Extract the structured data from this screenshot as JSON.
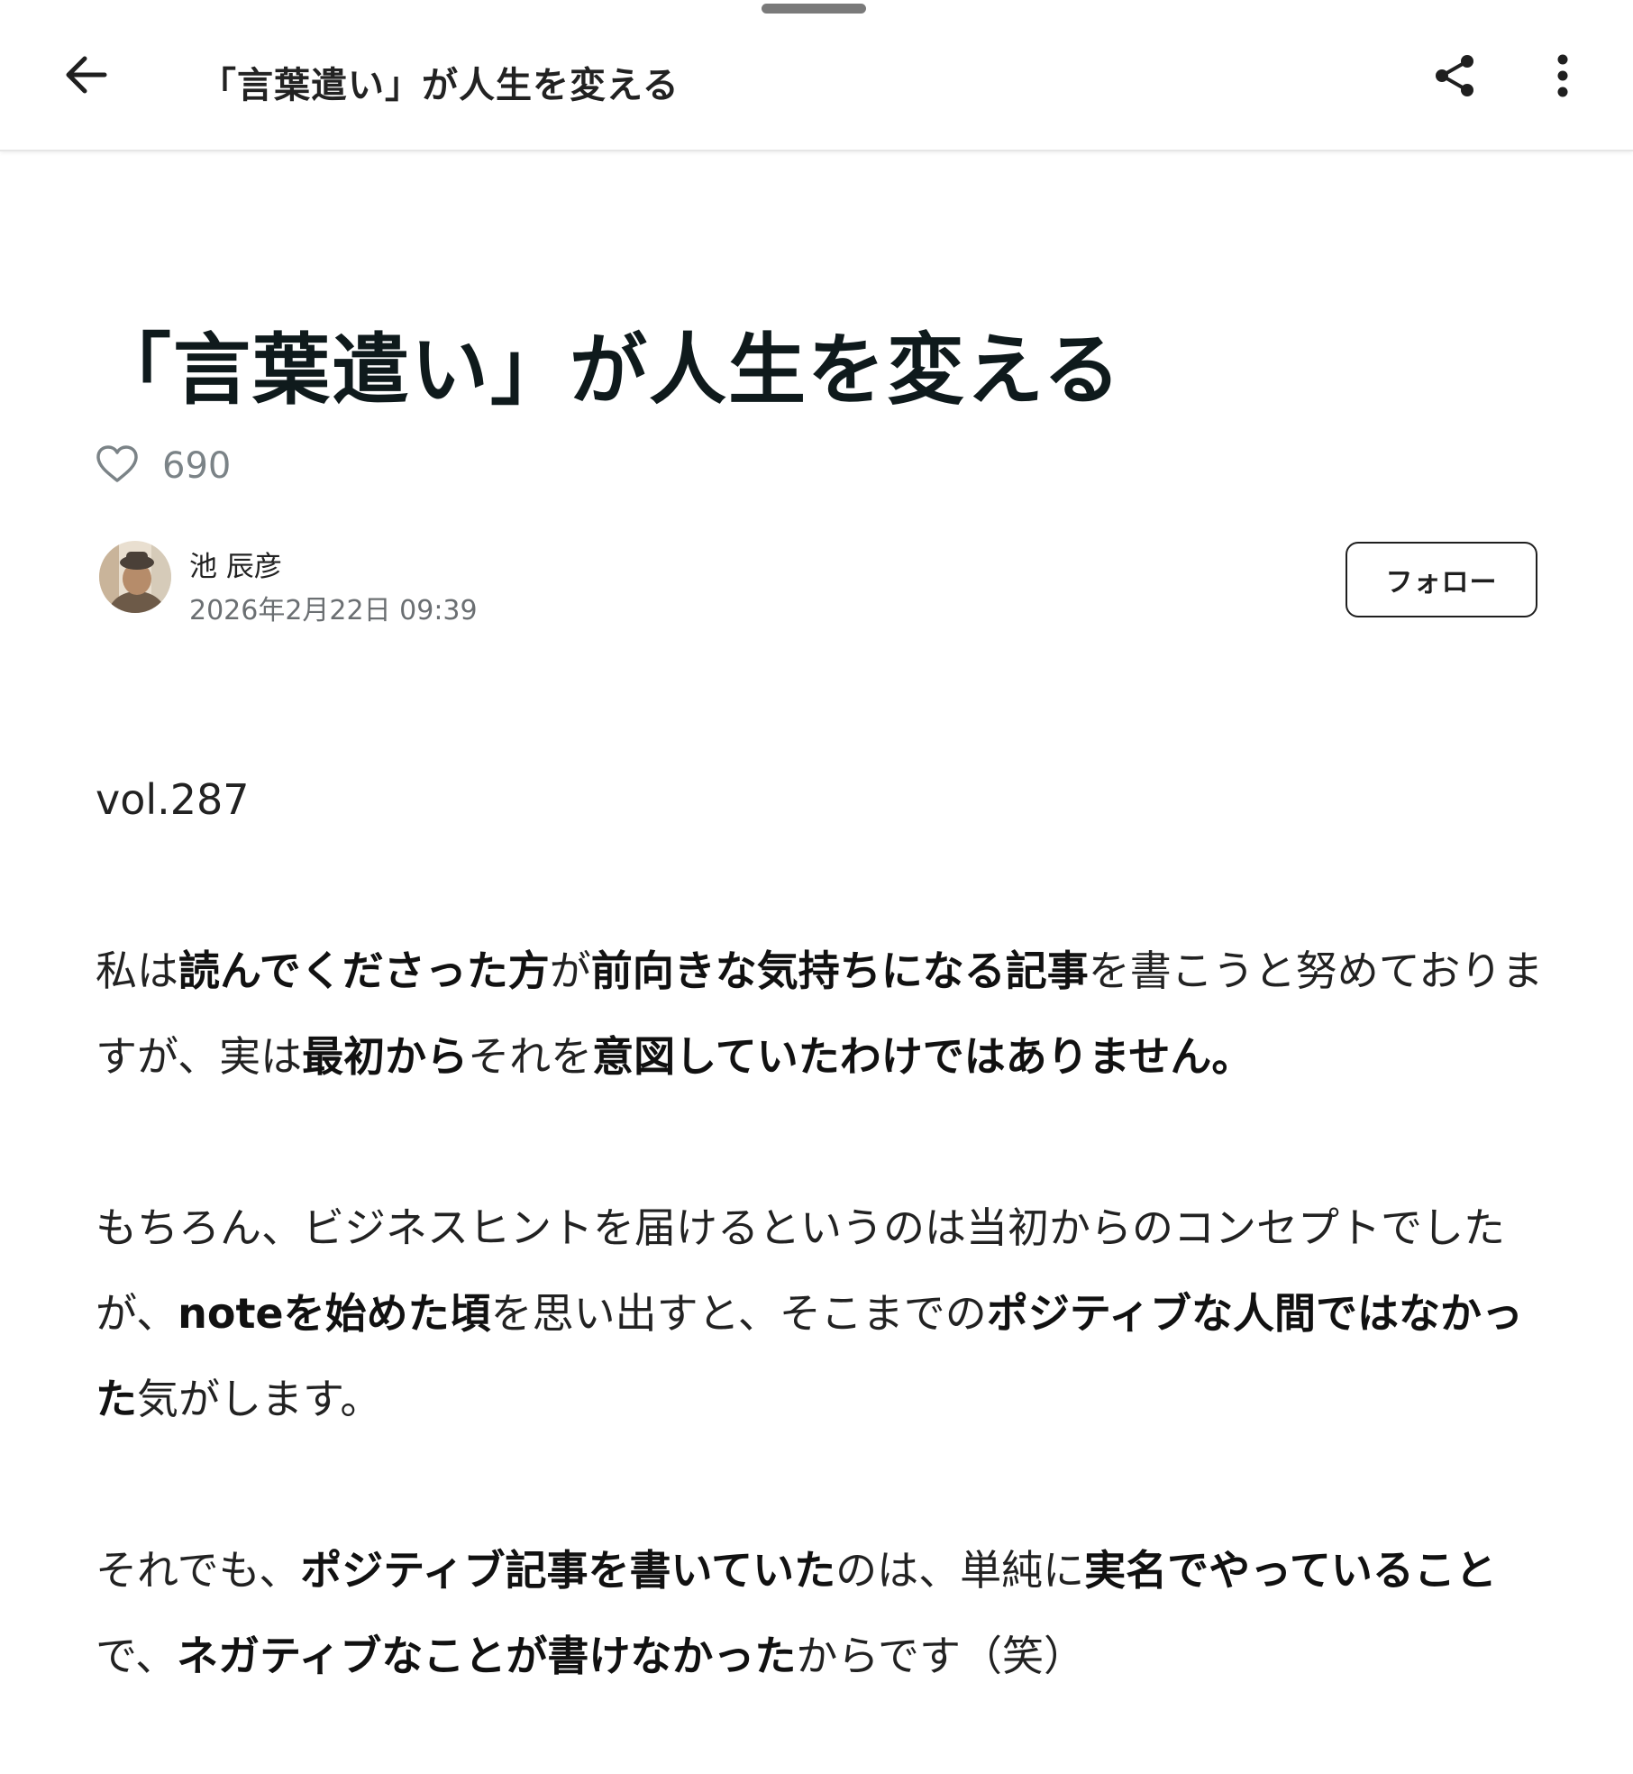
{
  "app_bar": {
    "title": "「言葉遣い」が人生を変える",
    "back_icon": "arrow-left-icon",
    "share_icon": "share-icon",
    "more_icon": "more-vert-icon"
  },
  "article": {
    "title": "「言葉遣い」が人生を変える",
    "likes": "690",
    "author": {
      "name": "池 辰彦",
      "date": "2026年2月22日 09:39",
      "follow_label": "フォロー"
    },
    "vol": "vol.287",
    "paragraphs": [
      {
        "runs": [
          {
            "text": "私は",
            "bold": false
          },
          {
            "text": "読んでくださった方",
            "bold": true
          },
          {
            "text": "が",
            "bold": false
          },
          {
            "text": "前向きな気持ちになる記事",
            "bold": true
          },
          {
            "text": "を書こうと努めておりますが、実は",
            "bold": false
          },
          {
            "text": "最初から",
            "bold": true
          },
          {
            "text": "それを",
            "bold": false
          },
          {
            "text": "意図していたわけではありません。",
            "bold": true
          }
        ]
      },
      {
        "runs": [
          {
            "text": "もちろん、ビジネスヒントを届けるというのは当初からのコンセプトでしたが、",
            "bold": false
          },
          {
            "text": "noteを始めた頃",
            "bold": true
          },
          {
            "text": "を思い出すと、そこまでの",
            "bold": false
          },
          {
            "text": "ポジティブな人間ではなかった",
            "bold": true
          },
          {
            "text": "気がします。",
            "bold": false
          }
        ]
      },
      {
        "runs": [
          {
            "text": "それでも、",
            "bold": false
          },
          {
            "text": "ポジティブ記事を書いていた",
            "bold": true
          },
          {
            "text": "のは、単純に",
            "bold": false
          },
          {
            "text": "実名でやっていること",
            "bold": true
          },
          {
            "text": "で、",
            "bold": false
          },
          {
            "text": "ネガティブなことが書けなかった",
            "bold": true
          },
          {
            "text": "からです（笑）",
            "bold": false
          }
        ]
      }
    ]
  },
  "colors": {
    "title": "#0f1a1c",
    "muted": "#7b8387",
    "border": "#1f1f1f"
  }
}
